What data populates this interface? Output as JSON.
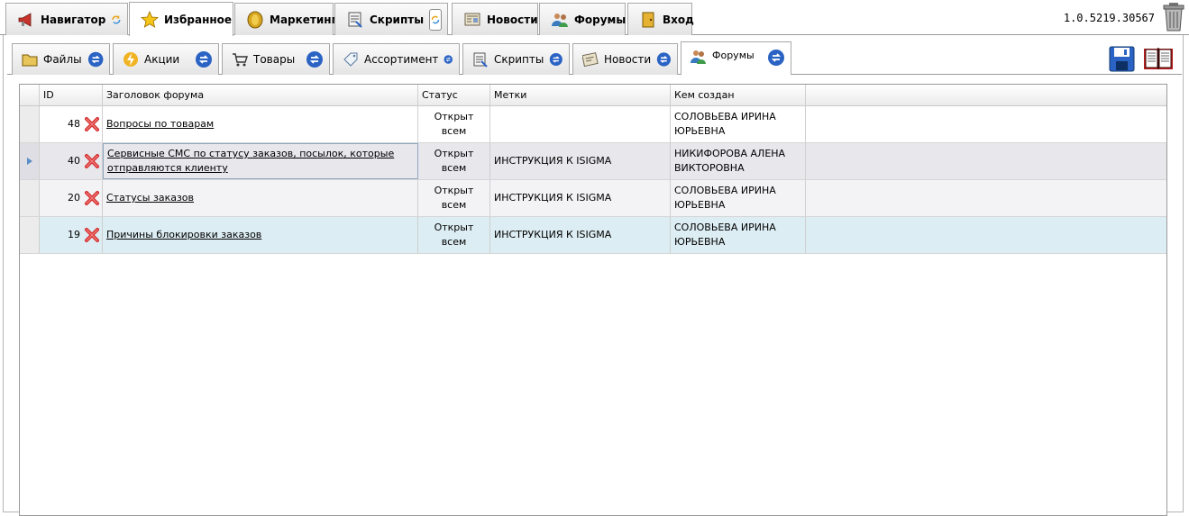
{
  "top_tabs": [
    {
      "label": "Навигатор",
      "icon": "megaphone-icon"
    },
    {
      "label": "Избранное",
      "icon": "star-icon"
    },
    {
      "label": "Маркетинг",
      "icon": "coin-icon"
    },
    {
      "label": "Скрипты",
      "icon": "script-icon"
    },
    {
      "label": "Новости",
      "icon": "newspaper-icon"
    },
    {
      "label": "Форумы",
      "icon": "users-icon"
    },
    {
      "label": "Вход",
      "icon": "door-icon"
    }
  ],
  "active_top_tab": "Избранное",
  "version": "1.0.5219.30567",
  "sub_tabs": [
    {
      "label": "Файлы",
      "icon": "folder-icon"
    },
    {
      "label": "Акции",
      "icon": "lightning-icon"
    },
    {
      "label": "Товары",
      "icon": "cart-icon"
    },
    {
      "label": "Ассортимент",
      "icon": "tag-icon"
    },
    {
      "label": "Скрипты",
      "icon": "script-icon"
    },
    {
      "label": "Новости",
      "icon": "newspaper-icon"
    },
    {
      "label": "Форумы",
      "icon": "users-icon"
    }
  ],
  "active_sub_tab": "Форумы",
  "grid": {
    "columns": [
      "ID",
      "Заголовок форума",
      "Статус",
      "Метки",
      "Кем создан"
    ],
    "rows": [
      {
        "id": "48",
        "title": "Вопросы по товарам",
        "status": "Открыт всем",
        "tags": "",
        "author": "СОЛОВЬЕВА ИРИНА ЮРЬЕВНА"
      },
      {
        "id": "40",
        "title": "Сервисные СМС по статусу заказов, посылок, которые отправляются клиенту",
        "status": "Открыт всем",
        "tags": "ИНСТРУКЦИЯ К ISIGMA",
        "author": "НИКИФОРОВА АЛЕНА ВИКТОРОВНА"
      },
      {
        "id": "20",
        "title": "Статусы заказов",
        "status": "Открыт всем",
        "tags": "ИНСТРУКЦИЯ К ISIGMA",
        "author": "СОЛОВЬЕВА ИРИНА ЮРЬЕВНА"
      },
      {
        "id": "19",
        "title": "Причины блокировки заказов",
        "status": "Открыт всем",
        "tags": "ИНСТРУКЦИЯ К ISIGMA",
        "author": "СОЛОВЬЕВА ИРИНА ЮРЬЕВНА"
      }
    ]
  },
  "colors": {
    "accent_blue": "#2a63c4",
    "row_hover": "#dcedf3",
    "row_current": "#e7e7ec",
    "delete_red": "#d42b2b"
  }
}
